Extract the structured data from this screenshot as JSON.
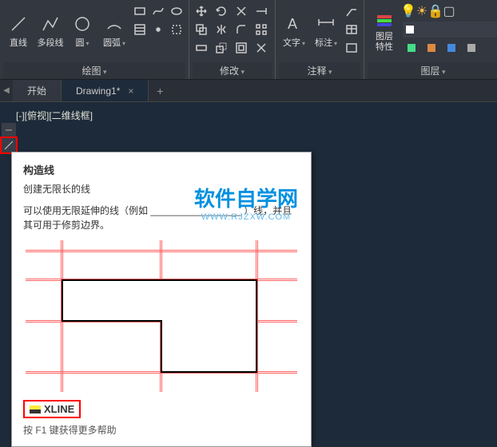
{
  "ribbon": {
    "draw": {
      "label": "绘图",
      "line": "直线",
      "pline": "多段线",
      "circle": "圆",
      "arc": "圆弧"
    },
    "modify": {
      "label": "修改"
    },
    "annotate": {
      "label": "注释",
      "text": "文字",
      "dim": "标注"
    },
    "layers": {
      "label": "图层",
      "props": "图层\n特性",
      "combo_value": ""
    }
  },
  "tabs": {
    "start": "开始",
    "drawing": "Drawing1*"
  },
  "viewport": "[-][俯视][二维线框]",
  "tooltip": {
    "title": "构造线",
    "subtitle": "创建无限长的线",
    "desc": "可以使用无限延伸的线（例如 _________________ ）线，并且其可用于修剪边界。",
    "command": "XLINE",
    "help": "按 F1 键获得更多帮助"
  },
  "watermark": {
    "line1": "软件自学网",
    "line2": "WWW.RJZXW.COM"
  }
}
